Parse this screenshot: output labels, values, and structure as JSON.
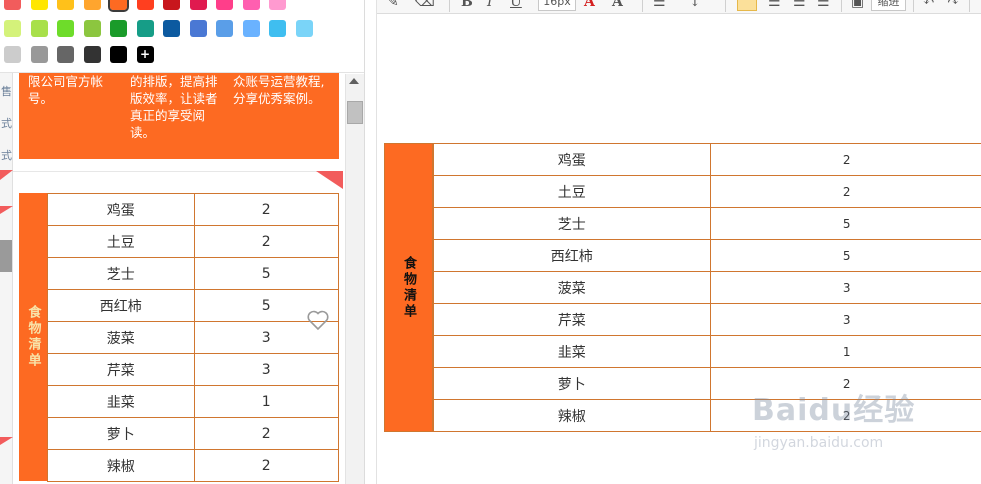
{
  "palette": {
    "rows": [
      [
        "#f25c5c",
        "#ffe600",
        "#ffc11a",
        "#ffa52e",
        "#fd6a22",
        "#ff3f1f",
        "#c8161d",
        "#e01a4f",
        "#ff3e8a",
        "#ff5fb0",
        "#ff9ad0"
      ],
      [
        "#d4f27a",
        "#a8e04a",
        "#6edc2a",
        "#8cc63f",
        "#1a9b2a",
        "#169d87",
        "#0c5aa0",
        "#4a78d4",
        "#5a9ee8",
        "#6ab2ff",
        "#3fbef0",
        "#7ad4f8"
      ],
      [
        "#cccccc",
        "#999999",
        "#666666",
        "#333333",
        "#000000"
      ]
    ],
    "add_label": "+"
  },
  "side_chars": [
    "售",
    "式",
    "式"
  ],
  "card": {
    "col1": "限公司官方帐号。",
    "col2": "的排版，提高排版效率，让读者真正的享受阅读。",
    "col3": "众账号运营教程,分享优秀案例。"
  },
  "table": {
    "label": "食物清单",
    "rows": [
      {
        "name": "鸡蛋",
        "qty": "2"
      },
      {
        "name": "土豆",
        "qty": "2"
      },
      {
        "name": "芝士",
        "qty": "5"
      },
      {
        "name": "西红柿",
        "qty": "5"
      },
      {
        "name": "菠菜",
        "qty": "3"
      },
      {
        "name": "芹菜",
        "qty": "3"
      },
      {
        "name": "韭菜",
        "qty": "1"
      },
      {
        "name": "萝卜",
        "qty": "2"
      },
      {
        "name": "辣椒",
        "qty": "2"
      }
    ]
  },
  "toolbar": {
    "font_size": "16px",
    "indent": "缩进",
    "bold": "B",
    "italic": "I",
    "underline": "U",
    "font_color": "A",
    "bg_color": "A"
  },
  "icons": {
    "heart": "heart-icon",
    "scroll_up": "arrow-up-icon"
  },
  "watermark": {
    "text": "Baidu经验",
    "url": "jingyan.baidu.com"
  }
}
